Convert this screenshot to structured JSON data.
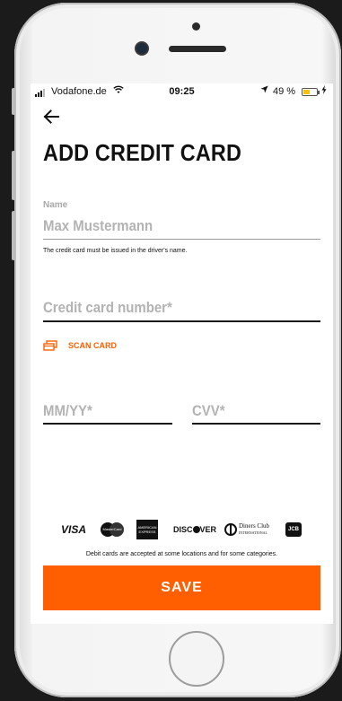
{
  "status_bar": {
    "carrier": "Vodafone.de",
    "wifi_icon": "wifi-icon",
    "time": "09:25",
    "location_icon": "location-arrow-icon",
    "battery_percent": "49 %",
    "battery_level": 0.49,
    "charging_icon": "bolt-icon"
  },
  "header": {
    "back_icon": "arrow-left-icon",
    "title": "ADD CREDIT CARD"
  },
  "form": {
    "name_label": "Name",
    "name_value": "Max Mustermann",
    "name_hint": "The credit card must be issued in the driver's name.",
    "card_number_placeholder": "Credit card number*",
    "scan_card_label": "SCAN CARD",
    "scan_icon": "cards-icon",
    "expiry_placeholder": "MM/YY*",
    "cvv_placeholder": "CVV*"
  },
  "card_logos": {
    "visa": "VISA",
    "mastercard": "MasterCard",
    "amex": "AMERICAN EXPRESS",
    "discover": "DISC",
    "discover_end": "VER",
    "diners": "Diners Club",
    "diners_sub": "INTERNATIONAL",
    "jcb": "JCB"
  },
  "footer": {
    "debit_note": "Debit cards are accepted at some locations and for some categories.",
    "save_label": "SAVE"
  },
  "colors": {
    "accent": "#ff5f00",
    "text": "#111111",
    "placeholder": "#b3b3b3"
  }
}
